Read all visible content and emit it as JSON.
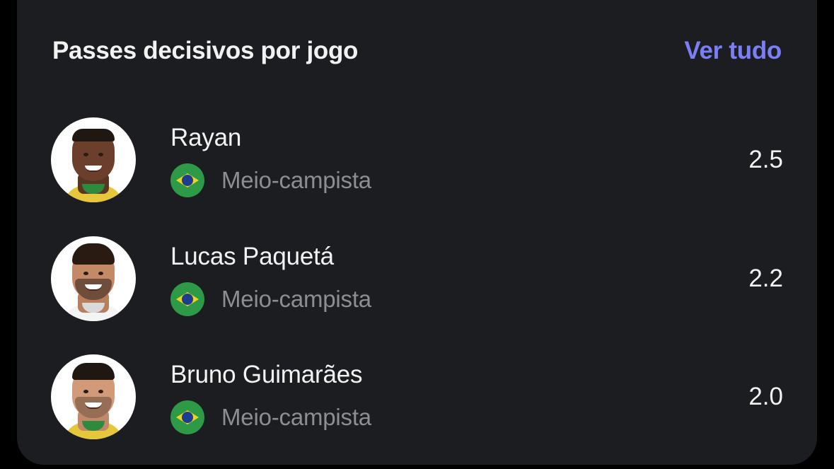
{
  "header": {
    "title": "Passes decisivos por jogo",
    "see_all_label": "Ver tudo"
  },
  "colors": {
    "card_background": "#1b1d20",
    "accent": "#7b7ff5",
    "primary_text": "#f2f2f2",
    "secondary_text": "#8d8e91"
  },
  "players": [
    {
      "name": "Rayan",
      "position": "Meio-campista",
      "nationality_icon": "brazil-flag-icon",
      "value": "2.5"
    },
    {
      "name": "Lucas Paquetá",
      "position": "Meio-campista",
      "nationality_icon": "brazil-flag-icon",
      "value": "2.2"
    },
    {
      "name": "Bruno Guimarães",
      "position": "Meio-campista",
      "nationality_icon": "brazil-flag-icon",
      "value": "2.0"
    }
  ]
}
